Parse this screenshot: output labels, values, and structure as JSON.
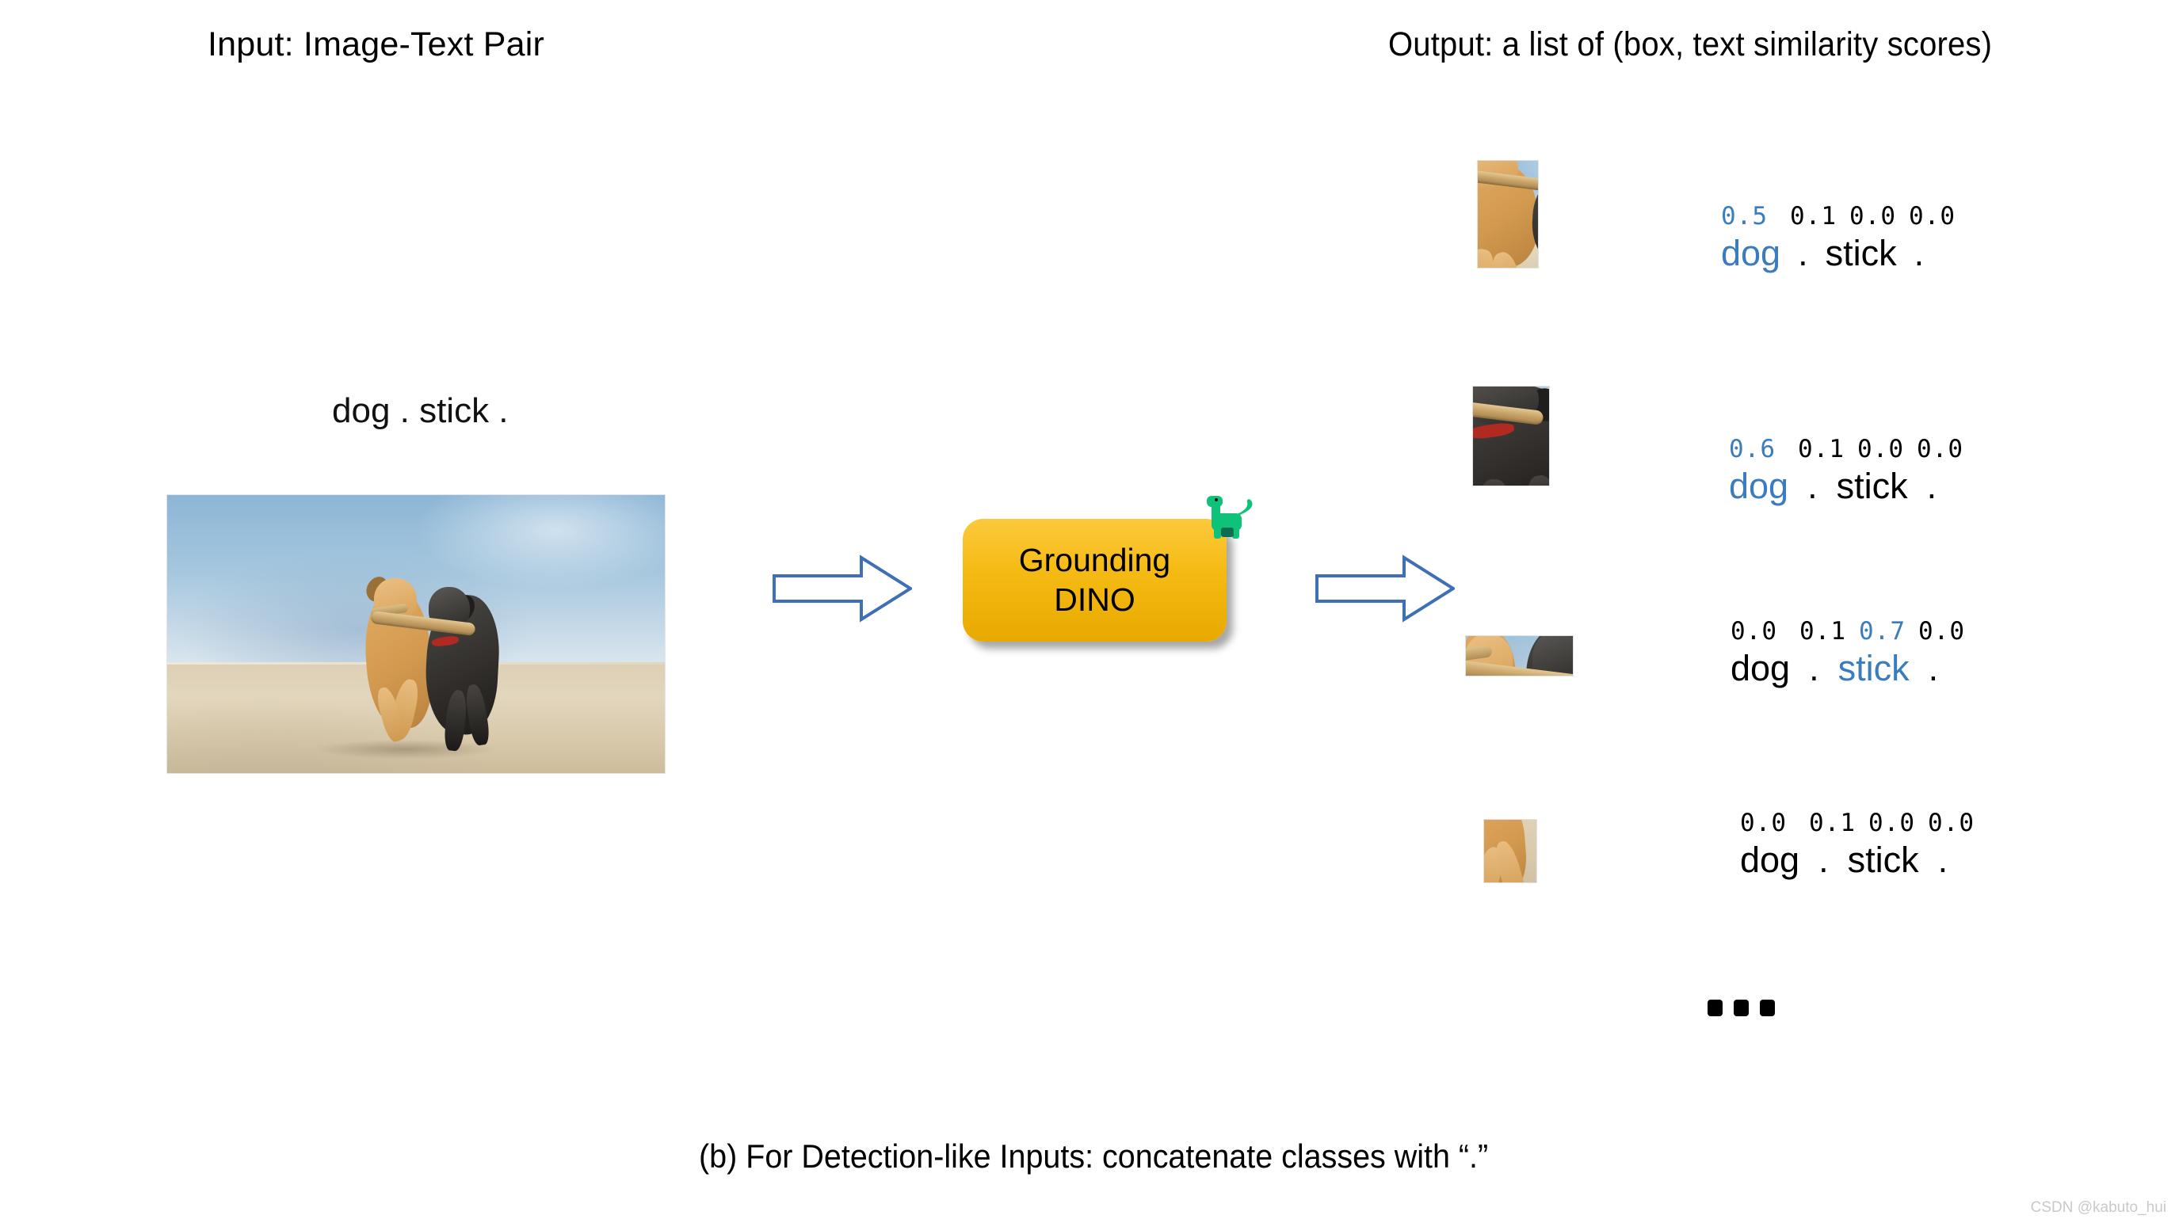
{
  "headers": {
    "input": "Input: Image-Text Pair",
    "output": "Output: a list of (box, text similarity scores)"
  },
  "input": {
    "prompt_text": "dog . stick .",
    "image_alt": "two dogs running on a beach carrying a stick"
  },
  "model": {
    "line1": "Grounding",
    "line2": "DINO",
    "box_color": "#f5bb14",
    "icon": "dinosaur-icon",
    "icon_color": "#0ec27a"
  },
  "arrows": {
    "color": "#3f6fb5",
    "arrow1_name": "arrow-image-to-model",
    "arrow2_name": "arrow-model-to-output"
  },
  "accent_color": "#3b7cbf",
  "output_rows": [
    {
      "crop_alt": "tan dog with stick",
      "scores": [
        "0.5",
        "0.1",
        "0.0",
        "0.0"
      ],
      "tokens": [
        "dog",
        ".",
        "stick",
        "."
      ],
      "highlight_index": 0
    },
    {
      "crop_alt": "black dog with stick and red collar",
      "scores": [
        "0.6",
        "0.1",
        "0.0",
        "0.0"
      ],
      "tokens": [
        "dog",
        ".",
        "stick",
        "."
      ],
      "highlight_index": 0
    },
    {
      "crop_alt": "stick held by both dogs",
      "scores": [
        "0.0",
        "0.1",
        "0.7",
        "0.0"
      ],
      "tokens": [
        "dog",
        ".",
        "stick",
        "."
      ],
      "highlight_index": 2
    },
    {
      "crop_alt": "tan dog front legs and paws",
      "scores": [
        "0.0",
        "0.1",
        "0.0",
        "0.0"
      ],
      "tokens": [
        "dog",
        ".",
        "stick",
        "."
      ],
      "highlight_index": -1
    }
  ],
  "ellipsis": "...",
  "caption": "(b) For Detection-like Inputs: concatenate classes with “.”",
  "watermark": "CSDN @kabuto_hui"
}
